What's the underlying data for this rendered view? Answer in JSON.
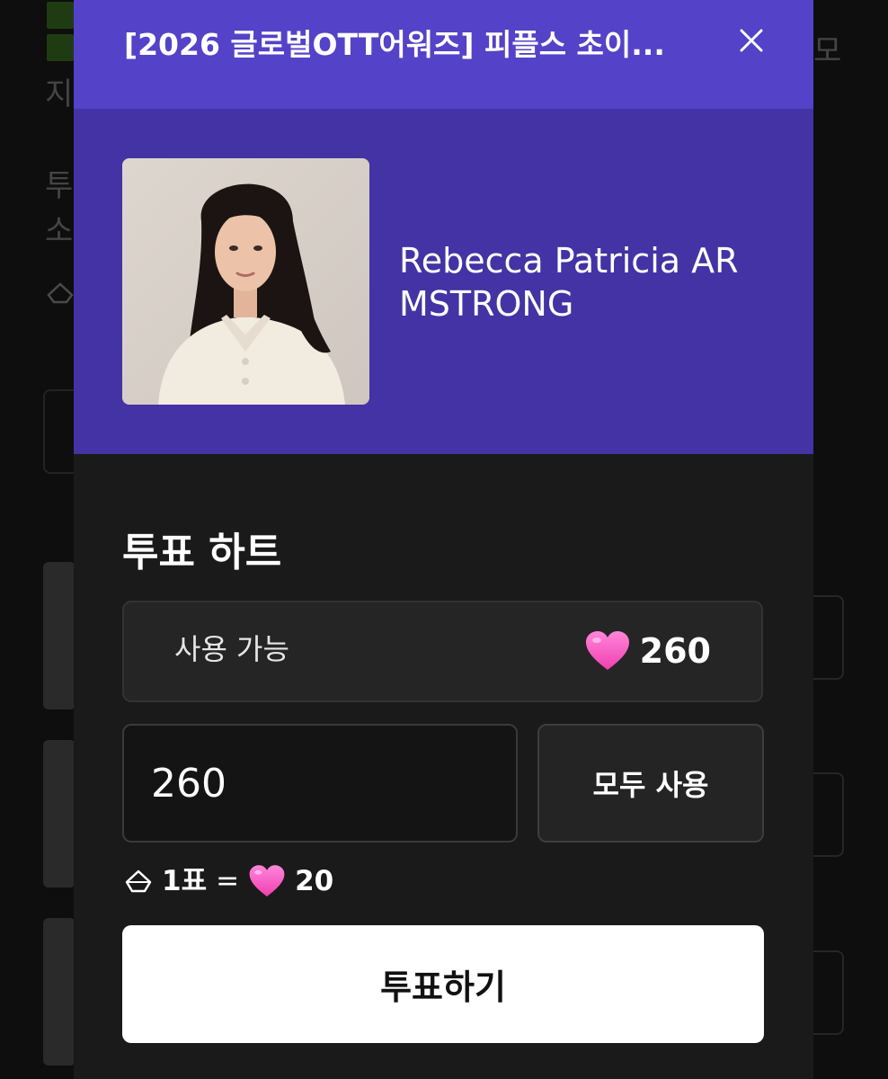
{
  "modal": {
    "title": "[2026 글로벌OTT어워즈] 피플스 초이...",
    "candidate_name": "Rebecca Patricia ARMSTRONG",
    "section_title": "투표 하트",
    "available_label": "사용 가능",
    "available_hearts": "260",
    "amount_value": "260",
    "use_all_label": "모두 사용",
    "rate_votes": "1표",
    "rate_equals": "=",
    "rate_hearts": "20",
    "vote_button_label": "투표하기"
  },
  "background": {
    "fragments": [
      "지",
      "투",
      "소",
      "모"
    ]
  },
  "icons": {
    "close": "close-icon",
    "heart": "heart-icon",
    "ticket": "ticket-icon"
  },
  "colors": {
    "header_purple": "#5442c8",
    "profile_purple": "#4333a4",
    "heart_pink": "#ff5fc9",
    "modal_bg": "#1a1a1a"
  }
}
